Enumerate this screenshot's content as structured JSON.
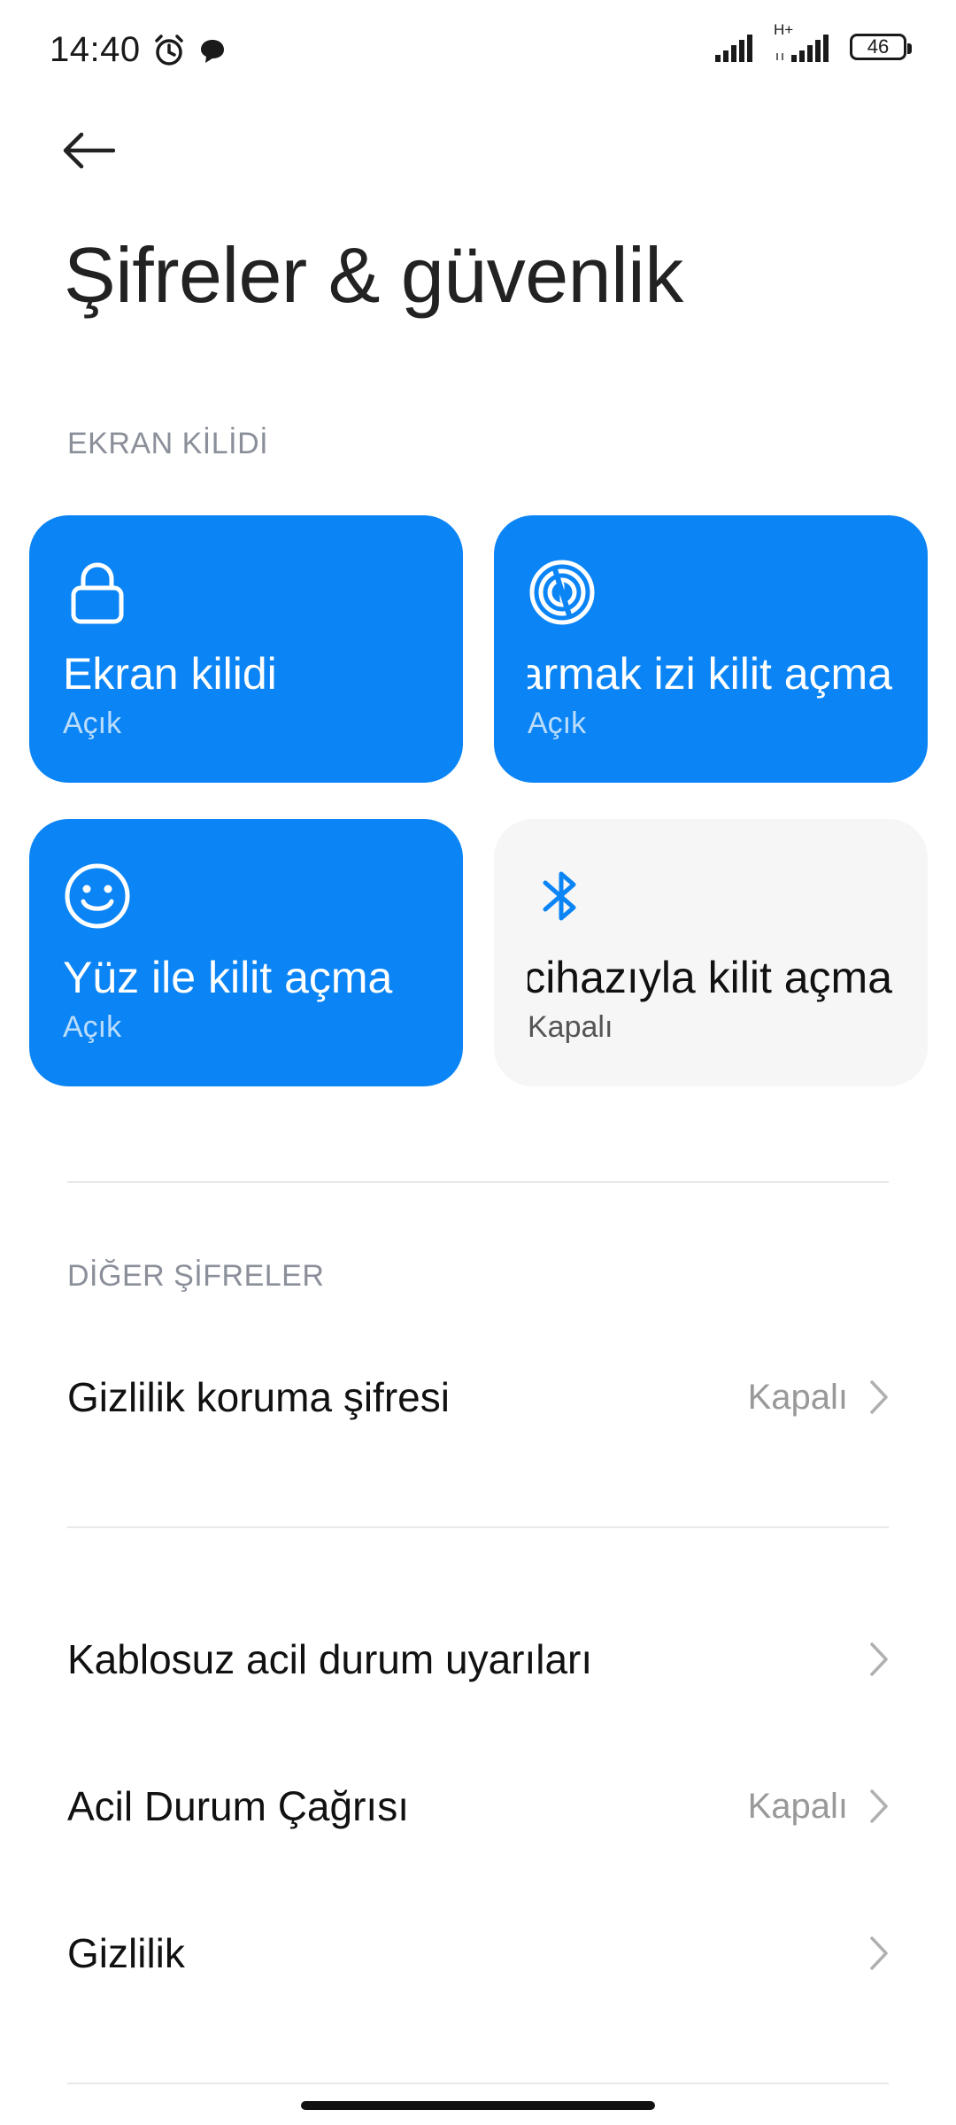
{
  "status_bar": {
    "time": "14:40",
    "network_label": "H+",
    "battery": "46"
  },
  "page": {
    "title": "Şifreler & güvenlik"
  },
  "sections": {
    "screen_lock": "EKRAN KİLİDİ",
    "other_passwords": "DİĞER ŞİFRELER"
  },
  "tiles": [
    {
      "title": "Ekran kilidi",
      "status": "Açık",
      "icon": "lock-icon",
      "on": true
    },
    {
      "title": "Parmak izi kilit açma",
      "status": "Açık",
      "icon": "fingerprint-icon",
      "on": true
    },
    {
      "title": "Yüz ile kilit açma",
      "status": "Açık",
      "icon": "face-icon",
      "on": true
    },
    {
      "title": "Bluetooth cihazıyla kilit açma",
      "status": "Kapalı",
      "icon": "bluetooth-icon",
      "on": false
    }
  ],
  "list": [
    {
      "label": "Gizlilik koruma şifresi",
      "value": "Kapalı"
    },
    {
      "label": "Kablosuz acil durum uyarıları",
      "value": ""
    },
    {
      "label": "Acil Durum Çağrısı",
      "value": "Kapalı"
    },
    {
      "label": "Gizlilik",
      "value": ""
    }
  ],
  "colors": {
    "accent": "#0b84f5",
    "tile_off": "#f6f6f6",
    "section_header": "#8a8f99"
  }
}
